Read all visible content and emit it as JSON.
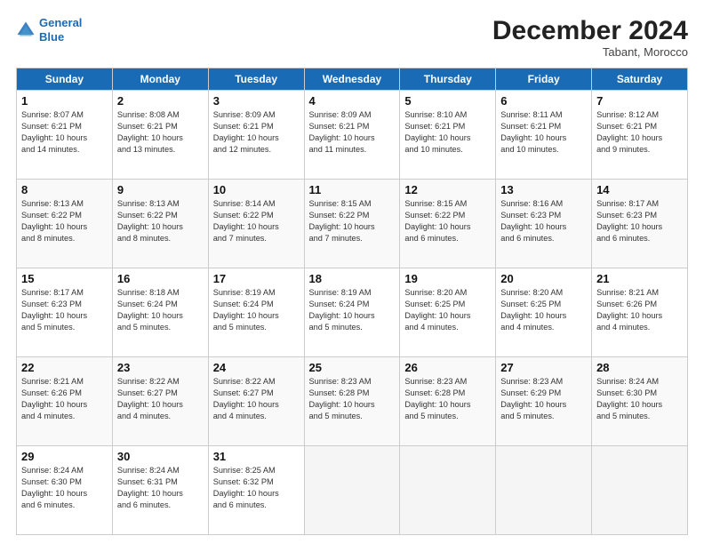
{
  "header": {
    "logo_line1": "General",
    "logo_line2": "Blue",
    "month_title": "December 2024",
    "location": "Tabant, Morocco"
  },
  "days_of_week": [
    "Sunday",
    "Monday",
    "Tuesday",
    "Wednesday",
    "Thursday",
    "Friday",
    "Saturday"
  ],
  "weeks": [
    [
      {
        "day": "1",
        "lines": [
          "Sunrise: 8:07 AM",
          "Sunset: 6:21 PM",
          "Daylight: 10 hours",
          "and 14 minutes."
        ]
      },
      {
        "day": "2",
        "lines": [
          "Sunrise: 8:08 AM",
          "Sunset: 6:21 PM",
          "Daylight: 10 hours",
          "and 13 minutes."
        ]
      },
      {
        "day": "3",
        "lines": [
          "Sunrise: 8:09 AM",
          "Sunset: 6:21 PM",
          "Daylight: 10 hours",
          "and 12 minutes."
        ]
      },
      {
        "day": "4",
        "lines": [
          "Sunrise: 8:09 AM",
          "Sunset: 6:21 PM",
          "Daylight: 10 hours",
          "and 11 minutes."
        ]
      },
      {
        "day": "5",
        "lines": [
          "Sunrise: 8:10 AM",
          "Sunset: 6:21 PM",
          "Daylight: 10 hours",
          "and 10 minutes."
        ]
      },
      {
        "day": "6",
        "lines": [
          "Sunrise: 8:11 AM",
          "Sunset: 6:21 PM",
          "Daylight: 10 hours",
          "and 10 minutes."
        ]
      },
      {
        "day": "7",
        "lines": [
          "Sunrise: 8:12 AM",
          "Sunset: 6:21 PM",
          "Daylight: 10 hours",
          "and 9 minutes."
        ]
      }
    ],
    [
      {
        "day": "8",
        "lines": [
          "Sunrise: 8:13 AM",
          "Sunset: 6:22 PM",
          "Daylight: 10 hours",
          "and 8 minutes."
        ]
      },
      {
        "day": "9",
        "lines": [
          "Sunrise: 8:13 AM",
          "Sunset: 6:22 PM",
          "Daylight: 10 hours",
          "and 8 minutes."
        ]
      },
      {
        "day": "10",
        "lines": [
          "Sunrise: 8:14 AM",
          "Sunset: 6:22 PM",
          "Daylight: 10 hours",
          "and 7 minutes."
        ]
      },
      {
        "day": "11",
        "lines": [
          "Sunrise: 8:15 AM",
          "Sunset: 6:22 PM",
          "Daylight: 10 hours",
          "and 7 minutes."
        ]
      },
      {
        "day": "12",
        "lines": [
          "Sunrise: 8:15 AM",
          "Sunset: 6:22 PM",
          "Daylight: 10 hours",
          "and 6 minutes."
        ]
      },
      {
        "day": "13",
        "lines": [
          "Sunrise: 8:16 AM",
          "Sunset: 6:23 PM",
          "Daylight: 10 hours",
          "and 6 minutes."
        ]
      },
      {
        "day": "14",
        "lines": [
          "Sunrise: 8:17 AM",
          "Sunset: 6:23 PM",
          "Daylight: 10 hours",
          "and 6 minutes."
        ]
      }
    ],
    [
      {
        "day": "15",
        "lines": [
          "Sunrise: 8:17 AM",
          "Sunset: 6:23 PM",
          "Daylight: 10 hours",
          "and 5 minutes."
        ]
      },
      {
        "day": "16",
        "lines": [
          "Sunrise: 8:18 AM",
          "Sunset: 6:24 PM",
          "Daylight: 10 hours",
          "and 5 minutes."
        ]
      },
      {
        "day": "17",
        "lines": [
          "Sunrise: 8:19 AM",
          "Sunset: 6:24 PM",
          "Daylight: 10 hours",
          "and 5 minutes."
        ]
      },
      {
        "day": "18",
        "lines": [
          "Sunrise: 8:19 AM",
          "Sunset: 6:24 PM",
          "Daylight: 10 hours",
          "and 5 minutes."
        ]
      },
      {
        "day": "19",
        "lines": [
          "Sunrise: 8:20 AM",
          "Sunset: 6:25 PM",
          "Daylight: 10 hours",
          "and 4 minutes."
        ]
      },
      {
        "day": "20",
        "lines": [
          "Sunrise: 8:20 AM",
          "Sunset: 6:25 PM",
          "Daylight: 10 hours",
          "and 4 minutes."
        ]
      },
      {
        "day": "21",
        "lines": [
          "Sunrise: 8:21 AM",
          "Sunset: 6:26 PM",
          "Daylight: 10 hours",
          "and 4 minutes."
        ]
      }
    ],
    [
      {
        "day": "22",
        "lines": [
          "Sunrise: 8:21 AM",
          "Sunset: 6:26 PM",
          "Daylight: 10 hours",
          "and 4 minutes."
        ]
      },
      {
        "day": "23",
        "lines": [
          "Sunrise: 8:22 AM",
          "Sunset: 6:27 PM",
          "Daylight: 10 hours",
          "and 4 minutes."
        ]
      },
      {
        "day": "24",
        "lines": [
          "Sunrise: 8:22 AM",
          "Sunset: 6:27 PM",
          "Daylight: 10 hours",
          "and 4 minutes."
        ]
      },
      {
        "day": "25",
        "lines": [
          "Sunrise: 8:23 AM",
          "Sunset: 6:28 PM",
          "Daylight: 10 hours",
          "and 5 minutes."
        ]
      },
      {
        "day": "26",
        "lines": [
          "Sunrise: 8:23 AM",
          "Sunset: 6:28 PM",
          "Daylight: 10 hours",
          "and 5 minutes."
        ]
      },
      {
        "day": "27",
        "lines": [
          "Sunrise: 8:23 AM",
          "Sunset: 6:29 PM",
          "Daylight: 10 hours",
          "and 5 minutes."
        ]
      },
      {
        "day": "28",
        "lines": [
          "Sunrise: 8:24 AM",
          "Sunset: 6:30 PM",
          "Daylight: 10 hours",
          "and 5 minutes."
        ]
      }
    ],
    [
      {
        "day": "29",
        "lines": [
          "Sunrise: 8:24 AM",
          "Sunset: 6:30 PM",
          "Daylight: 10 hours",
          "and 6 minutes."
        ]
      },
      {
        "day": "30",
        "lines": [
          "Sunrise: 8:24 AM",
          "Sunset: 6:31 PM",
          "Daylight: 10 hours",
          "and 6 minutes."
        ]
      },
      {
        "day": "31",
        "lines": [
          "Sunrise: 8:25 AM",
          "Sunset: 6:32 PM",
          "Daylight: 10 hours",
          "and 6 minutes."
        ]
      },
      null,
      null,
      null,
      null
    ]
  ]
}
